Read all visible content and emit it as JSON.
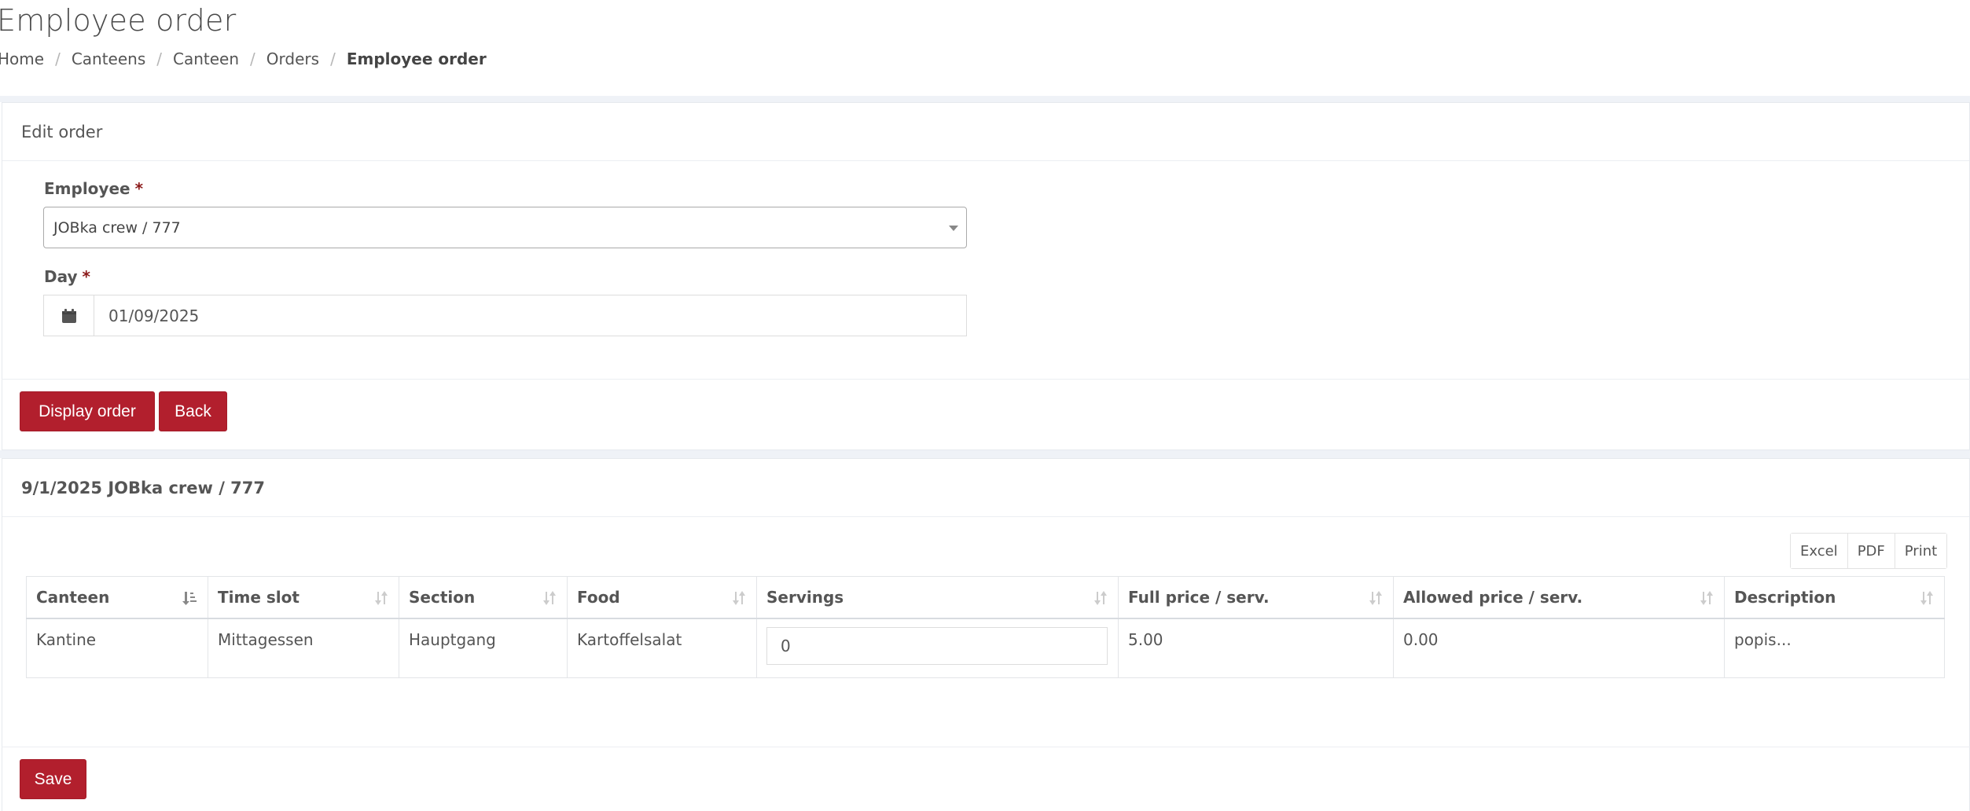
{
  "page": {
    "title": "Employee order",
    "breadcrumb": [
      "Home",
      "Canteens",
      "Canteen",
      "Orders",
      "Employee order"
    ]
  },
  "edit_card": {
    "header": "Edit order",
    "employee_label": "Employee",
    "employee_value": "JOBka crew / 777",
    "day_label": "Day",
    "day_value": "01/09/2025",
    "required_mark": "*",
    "calendar_icon": "calendar-icon",
    "display_button": "Display order",
    "back_button": "Back"
  },
  "order_card": {
    "header": "9/1/2025 JOBka crew / 777",
    "export_buttons": [
      "Excel",
      "PDF",
      "Print"
    ],
    "columns": [
      "Canteen",
      "Time slot",
      "Section",
      "Food",
      "Servings",
      "Full price / serv.",
      "Allowed price / serv.",
      "Description"
    ],
    "rows": [
      {
        "canteen": "Kantine",
        "time_slot": "Mittagessen",
        "section": "Hauptgang",
        "food": "Kartoffelsalat",
        "servings": "0",
        "full_price": "5.00",
        "allowed_price": "0.00",
        "description": "popis..."
      }
    ],
    "save_button": "Save"
  },
  "colors": {
    "primary": "#b21f2d",
    "band": "#eff2f7",
    "required": "#8b1a1a"
  }
}
